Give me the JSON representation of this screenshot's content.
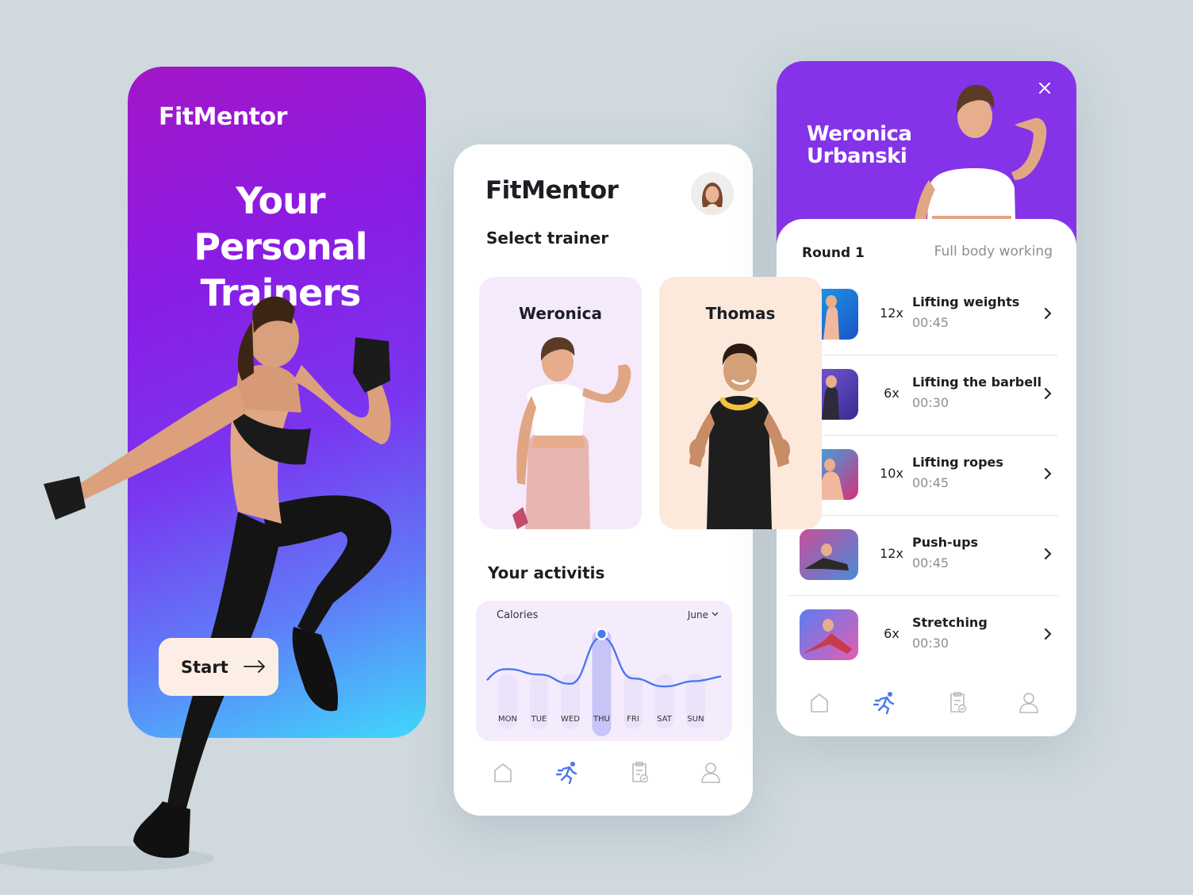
{
  "onboarding": {
    "brand": "FitMentor",
    "headline": "Your Personal Trainers",
    "start_label": "Start"
  },
  "trainers_screen": {
    "brand": "FitMentor",
    "subtitle": "Select trainer",
    "trainers": [
      {
        "name": "Weronica"
      },
      {
        "name": "Thomas"
      }
    ],
    "activities_title": "Your activitis",
    "tabs": [
      "home-icon",
      "workout-icon",
      "clipboard-check-icon",
      "profile-icon"
    ]
  },
  "chart_data": {
    "type": "area",
    "title": "Calories",
    "filter": "June",
    "categories": [
      "MON",
      "TUE",
      "WED",
      "THU",
      "FRI",
      "SAT",
      "SUN"
    ],
    "values": [
      52,
      44,
      30,
      100,
      38,
      26,
      34
    ],
    "highlighted": "THU",
    "colors": {
      "line": "#4a78ef",
      "highlight": "#c7c4f7",
      "background": "#f4ecfd"
    }
  },
  "workout_screen": {
    "trainer_name": "Weronica Urbanski",
    "round": "Round 1",
    "focus": "Full body working",
    "exercises": [
      {
        "reps": "12x",
        "name": "Lifting weights",
        "time": "00:45"
      },
      {
        "reps": "6x",
        "name": "Lifting the barbell",
        "time": "00:30"
      },
      {
        "reps": "10x",
        "name": "Lifting ropes",
        "time": "00:45"
      },
      {
        "reps": "12x",
        "name": "Push-ups",
        "time": "00:45"
      },
      {
        "reps": "6x",
        "name": "Stretching",
        "time": "00:30"
      }
    ],
    "tabs": [
      "home-icon",
      "workout-icon",
      "clipboard-check-icon",
      "profile-icon"
    ]
  },
  "colors": {
    "background": "#cfd9de",
    "brand_purple": "#8533e9",
    "accent_blue": "#4a78ef",
    "start_button": "#fceee4"
  }
}
